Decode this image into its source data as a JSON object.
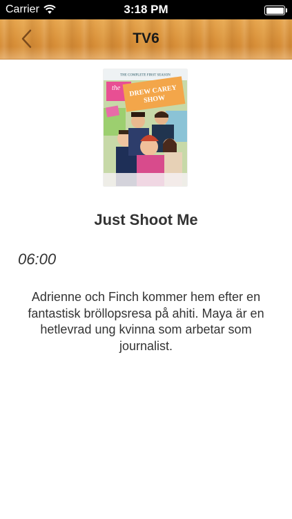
{
  "status_bar": {
    "carrier": "Carrier",
    "time": "3:18 PM",
    "battery_level": 1.0
  },
  "nav": {
    "title": "TV6",
    "back_icon": "chevron-left-icon"
  },
  "program": {
    "cover_title_top": "THE COMPLETE FIRST SEASON",
    "cover_title_the": "the",
    "cover_title_line1": "DREW CAREY",
    "cover_title_line2": "SHOW",
    "title": "Just Shoot Me",
    "time": "06:00",
    "description": "Adrienne och Finch kommer hem efter en fantastisk bröllopsresa på ahiti. Maya är en hetlevrad ung kvinna som arbetar som journalist."
  },
  "colors": {
    "nav_wood": "#d9913a",
    "text": "#333333"
  }
}
